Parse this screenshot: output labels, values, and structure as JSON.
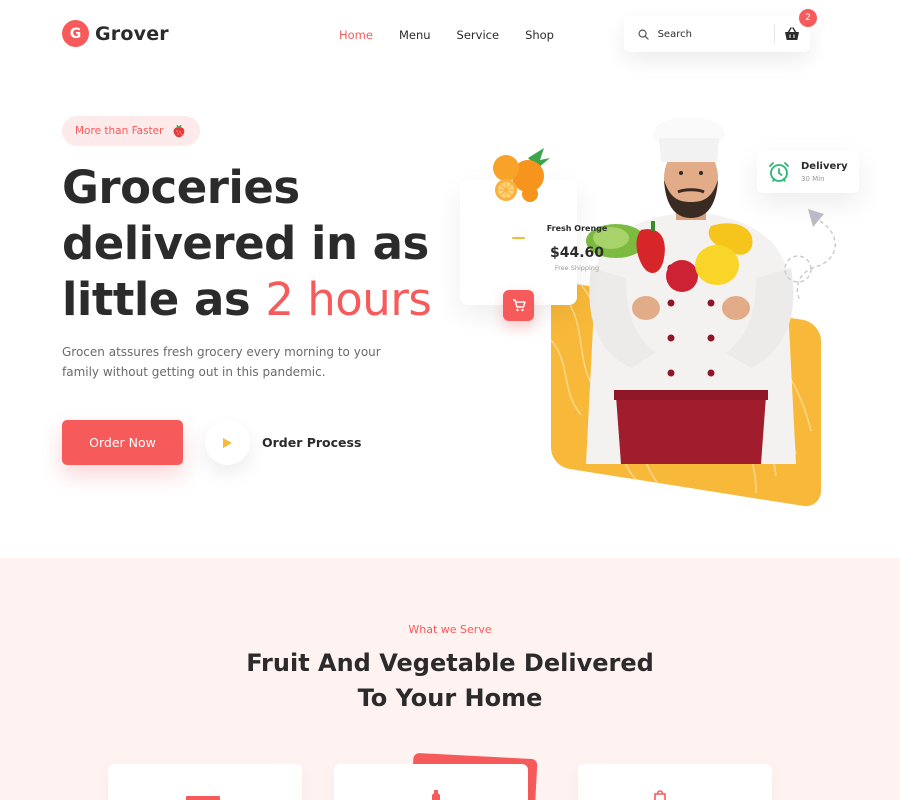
{
  "brand": {
    "name": "Grover",
    "logo_letter": "G"
  },
  "nav": {
    "items": [
      {
        "label": "Home",
        "active": true
      },
      {
        "label": "Menu",
        "active": false
      },
      {
        "label": "Service",
        "active": false
      },
      {
        "label": "Shop",
        "active": false
      }
    ]
  },
  "search": {
    "placeholder": "Search"
  },
  "cart": {
    "count": "2"
  },
  "hero": {
    "tag": "More than Faster",
    "headline_line1": "Groceries",
    "headline_line2": "delivered in as",
    "headline_line3_prefix": "little as ",
    "headline_line3_accent": "2 hours",
    "subtext": "Grocen atssures fresh grocery every morning to your family without getting out in this pandemic.",
    "primary_cta": "Order Now",
    "secondary_cta": "Order Process"
  },
  "product_card": {
    "name": "Fresh Orenge",
    "price": "$44.60",
    "shipping": "Free Shipping"
  },
  "delivery_card": {
    "title": "Delivery",
    "time": "30 Min"
  },
  "serve": {
    "kicker": "What we Serve",
    "title_line1": "Fruit And Vegetable Delivered",
    "title_line2": "To Your Home"
  },
  "colors": {
    "accent": "#f75a5a",
    "yellow": "#f8b93a",
    "section_bg": "#fff3f2",
    "text": "#2b2b2b",
    "delivery_icon": "#2bb673"
  }
}
